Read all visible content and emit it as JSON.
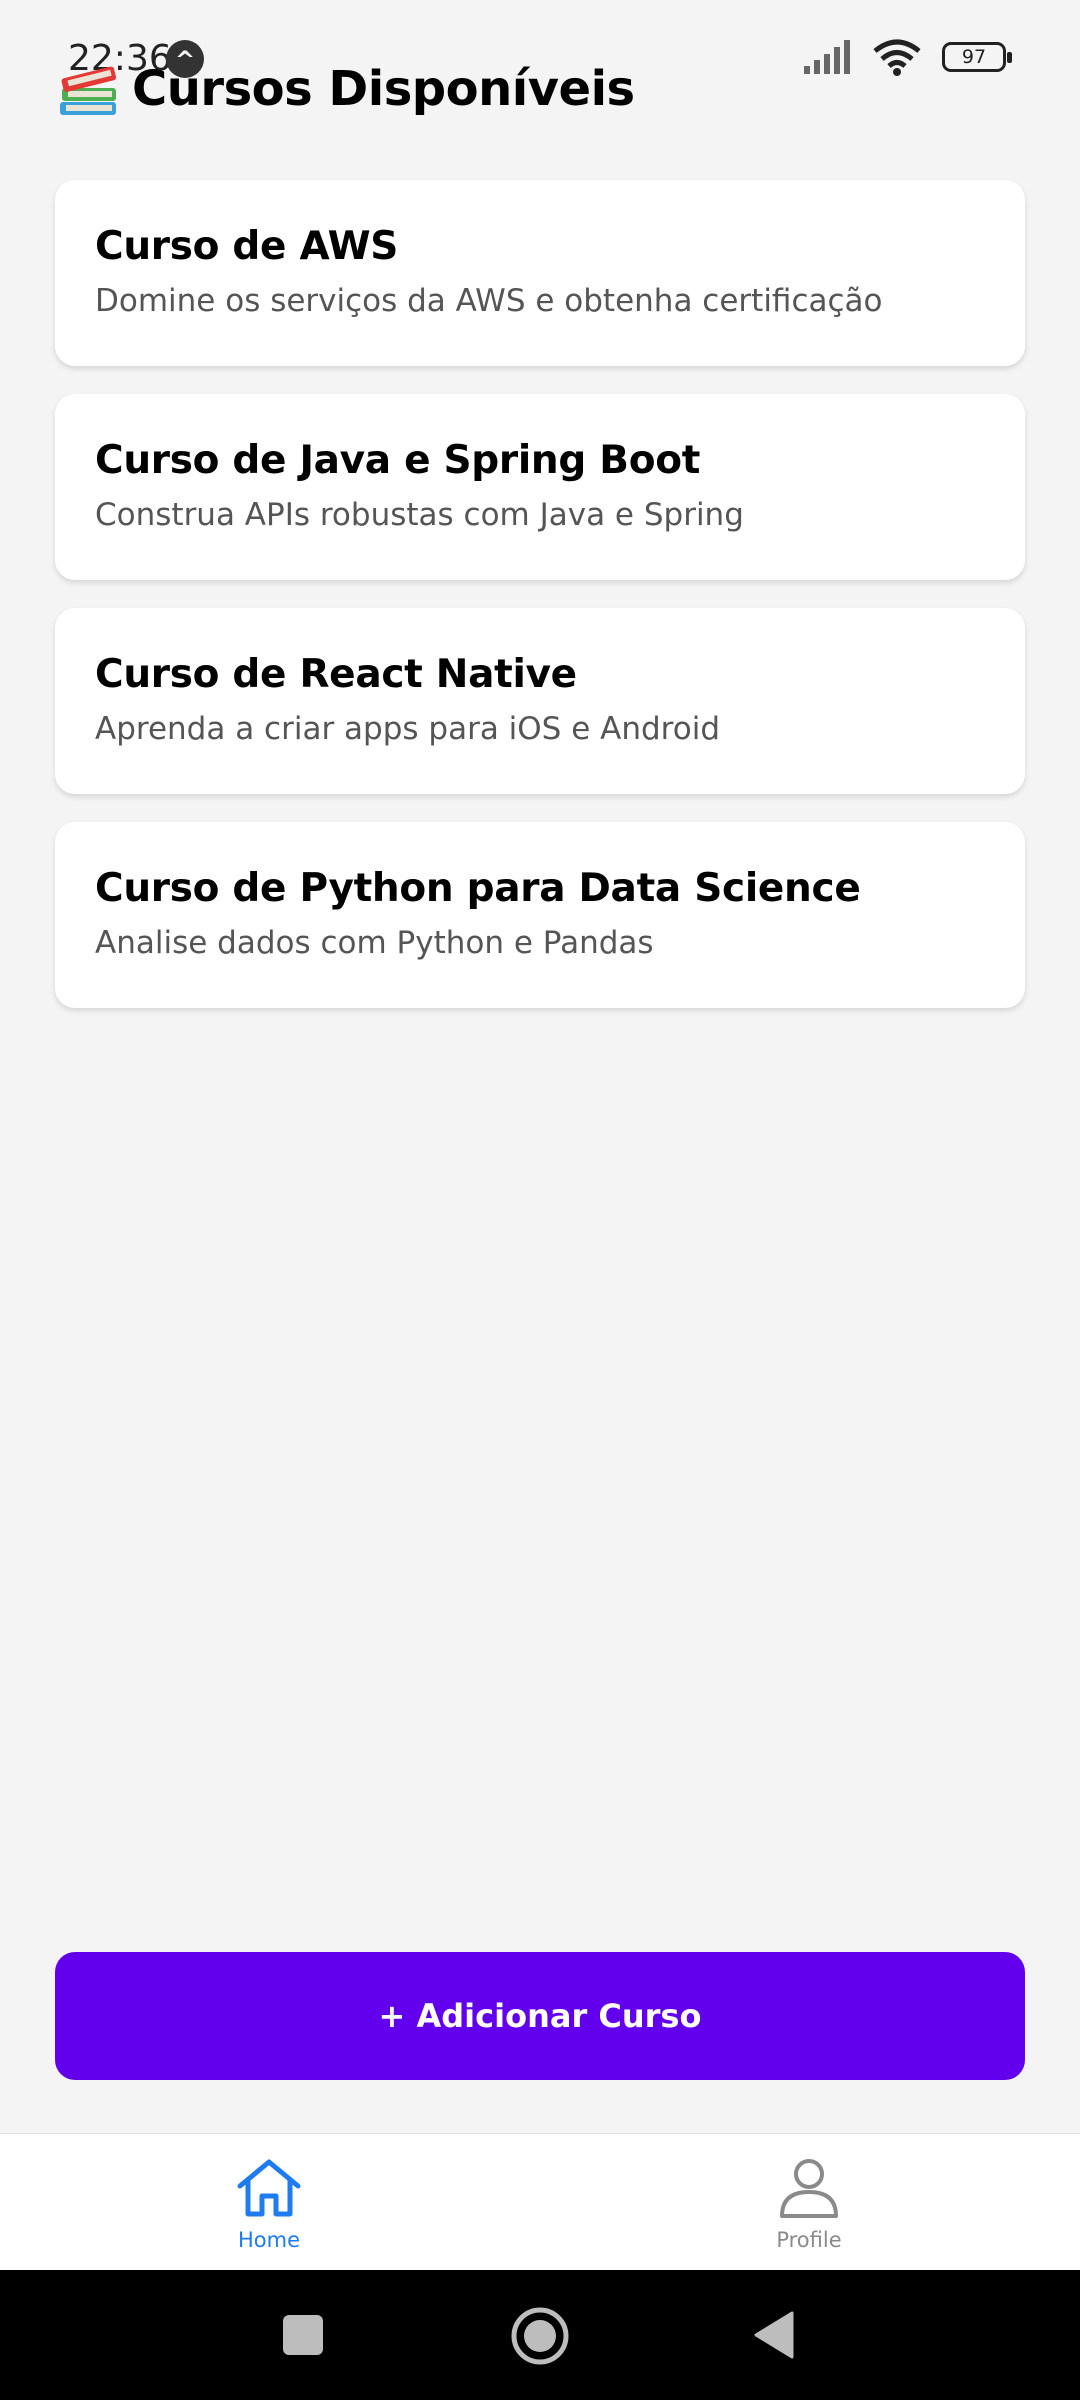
{
  "status_bar": {
    "time": "22:36",
    "notification_glyph": "^",
    "battery": "97"
  },
  "header": {
    "title": "Cursos Disponíveis",
    "icon": "books-icon"
  },
  "courses": [
    {
      "title": "Curso de AWS",
      "description": "Domine os serviços da AWS e obtenha certificação"
    },
    {
      "title": "Curso de Java e Spring Boot",
      "description": "Construa APIs robustas com Java e Spring"
    },
    {
      "title": "Curso de React Native",
      "description": "Aprenda a criar apps para iOS e Android"
    },
    {
      "title": "Curso de Python para Data Science",
      "description": "Analise dados com Python e Pandas"
    }
  ],
  "add_button": {
    "label": "+ Adicionar Curso",
    "color": "#6200ee"
  },
  "tabs": [
    {
      "label": "Home",
      "icon": "home-icon",
      "active": true,
      "color": "#1e7bf0"
    },
    {
      "label": "Profile",
      "icon": "user-icon",
      "active": false,
      "color": "#8a8a8a"
    }
  ],
  "android_nav": {
    "recents": "square-icon",
    "home": "circle-icon",
    "back": "triangle-back-icon"
  }
}
